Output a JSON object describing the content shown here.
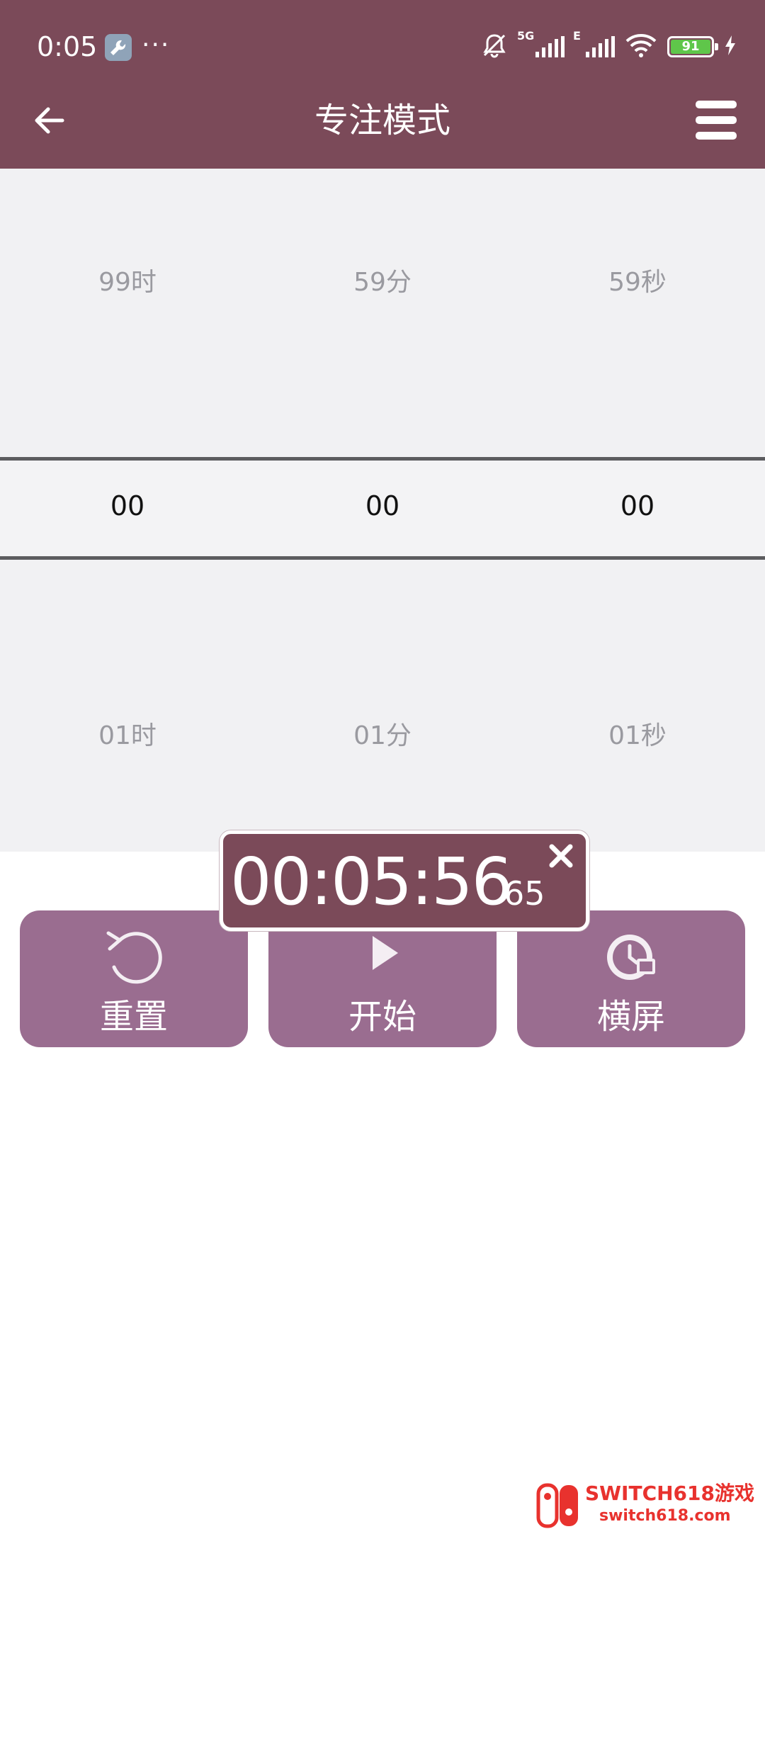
{
  "status_bar": {
    "time": "0:05",
    "overflow": "···",
    "signal_1_label": "5G",
    "signal_2_label": "E",
    "battery": "91",
    "icons": [
      "wrench-icon",
      "mute-bell-icon",
      "signal-icon",
      "wifi-icon",
      "battery-icon",
      "charging-icon"
    ]
  },
  "app_bar": {
    "title": "专注模式",
    "back_icon": "arrow-left-icon",
    "menu_icon": "hamburger-menu-icon"
  },
  "picker": {
    "top": {
      "hours": "99时",
      "minutes": "59分",
      "seconds": "59秒"
    },
    "selected": {
      "hours": "00",
      "minutes": "00",
      "seconds": "00"
    },
    "bottom": {
      "hours": "01时",
      "minutes": "01分",
      "seconds": "01秒"
    }
  },
  "actions": {
    "reset": {
      "label": "重置",
      "icon": "rotate-ccw-icon"
    },
    "start": {
      "label": "开始",
      "icon": "play-icon"
    },
    "landscape": {
      "label": "横屏",
      "icon": "clock-screen-icon"
    }
  },
  "floating_timer": {
    "time": "00:05:56",
    "centiseconds": "65",
    "close_icon": "close-icon"
  },
  "watermark": {
    "title": "SWITCH618游戏",
    "subtitle": "switch618.com"
  },
  "colors": {
    "primary": "#7b4a59",
    "button": "#9a6d90",
    "picker_bg": "#f1f1f3",
    "watermark": "#e8322e"
  }
}
